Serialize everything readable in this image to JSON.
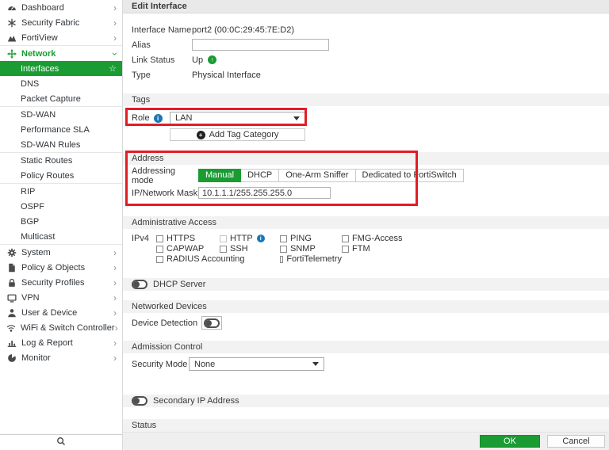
{
  "colors": {
    "accent_green": "#1a9c33",
    "highlight_red": "#e11d25",
    "info_blue": "#1b78b5"
  },
  "icons": {
    "chevron": "›",
    "star": "☆",
    "up_arrow": "↑",
    "info": "i",
    "plus": "+"
  },
  "sidebar": {
    "items": [
      {
        "label": "Dashboard"
      },
      {
        "label": "Security Fabric"
      },
      {
        "label": "FortiView"
      },
      {
        "label": "Network"
      },
      {
        "label": "Interfaces"
      },
      {
        "label": "DNS"
      },
      {
        "label": "Packet Capture"
      },
      {
        "label": "SD-WAN"
      },
      {
        "label": "Performance SLA"
      },
      {
        "label": "SD-WAN Rules"
      },
      {
        "label": "Static Routes"
      },
      {
        "label": "Policy Routes"
      },
      {
        "label": "RIP"
      },
      {
        "label": "OSPF"
      },
      {
        "label": "BGP"
      },
      {
        "label": "Multicast"
      },
      {
        "label": "System"
      },
      {
        "label": "Policy & Objects"
      },
      {
        "label": "Security Profiles"
      },
      {
        "label": "VPN"
      },
      {
        "label": "User & Device"
      },
      {
        "label": "WiFi & Switch Controller"
      },
      {
        "label": "Log & Report"
      },
      {
        "label": "Monitor"
      }
    ]
  },
  "header": {
    "title": "Edit Interface"
  },
  "form": {
    "interface_name_label": "Interface Name",
    "interface_name_value": "port2 (00:0C:29:45:7E:D2)",
    "alias_label": "Alias",
    "alias_value": "",
    "link_status_label": "Link Status",
    "link_status_value": "Up",
    "type_label": "Type",
    "type_value": "Physical Interface"
  },
  "tags": {
    "section_title": "Tags",
    "role_label": "Role",
    "role_value": "LAN",
    "add_tag_label": "Add Tag Category"
  },
  "address": {
    "section_title": "Address",
    "addressing_mode_label": "Addressing mode",
    "modes": [
      "Manual",
      "DHCP",
      "One-Arm Sniffer",
      "Dedicated to FortiSwitch"
    ],
    "selected_mode": "Manual",
    "ip_label": "IP/Network Mask",
    "ip_value": "10.1.1.1/255.255.255.0"
  },
  "admin_access": {
    "section_title": "Administrative Access",
    "ipv4_label": "IPv4",
    "rows": [
      [
        "HTTPS",
        "HTTP",
        "PING",
        "FMG-Access"
      ],
      [
        "CAPWAP",
        "SSH",
        "SNMP",
        "FTM"
      ],
      [
        "RADIUS Accounting",
        "FortiTelemetry"
      ]
    ]
  },
  "dhcp": {
    "section_title": "DHCP Server",
    "enabled": false
  },
  "networked_devices": {
    "section_title": "Networked Devices",
    "device_detection_label": "Device Detection",
    "enabled": false
  },
  "admission": {
    "section_title": "Admission Control",
    "security_mode_label": "Security Mode",
    "security_mode_value": "None"
  },
  "secondary_ip": {
    "section_title": "Secondary IP Address",
    "enabled": false
  },
  "status": {
    "section_title": "Status"
  },
  "footer": {
    "ok_label": "OK",
    "cancel_label": "Cancel"
  }
}
